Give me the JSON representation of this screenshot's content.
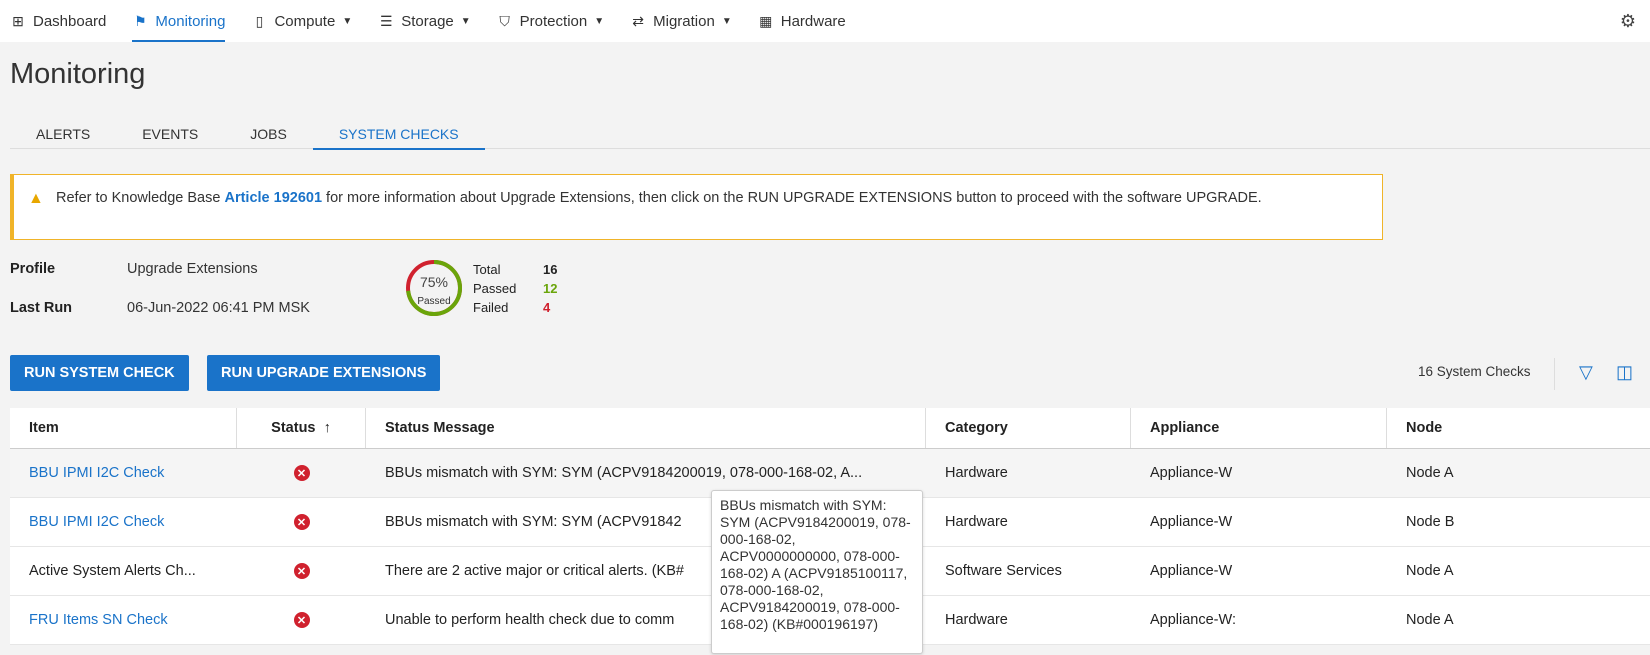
{
  "nav": {
    "items": [
      {
        "label": "Dashboard",
        "icon": "grid-icon"
      },
      {
        "label": "Monitoring",
        "icon": "flag-icon",
        "active": true
      },
      {
        "label": "Compute",
        "icon": "device-icon",
        "dropdown": true
      },
      {
        "label": "Storage",
        "icon": "database-icon",
        "dropdown": true
      },
      {
        "label": "Protection",
        "icon": "shield-icon",
        "dropdown": true
      },
      {
        "label": "Migration",
        "icon": "migration-icon",
        "dropdown": true
      },
      {
        "label": "Hardware",
        "icon": "hardware-icon"
      }
    ]
  },
  "page_title": "Monitoring",
  "tabs": [
    "ALERTS",
    "EVENTS",
    "JOBS",
    "SYSTEM CHECKS"
  ],
  "banner": {
    "pre": "Refer to Knowledge Base ",
    "link": "Article 192601",
    "post": " for more information about Upgrade Extensions, then click on the RUN UPGRADE EXTENSIONS button to proceed with the software UPGRADE."
  },
  "profile": {
    "label": "Profile",
    "value": "Upgrade Extensions"
  },
  "last_run": {
    "label": "Last Run",
    "value": "06-Jun-2022 06:41 PM MSK"
  },
  "summary": {
    "percent": "75%",
    "percent_value": 75,
    "percent_label": "Passed",
    "total_label": "Total",
    "total": "16",
    "passed_label": "Passed",
    "passed": "12",
    "failed_label": "Failed",
    "failed": "4",
    "colors": {
      "passed": "#6aa50a",
      "failed": "#d0212e"
    }
  },
  "buttons": {
    "run_system_check": "RUN SYSTEM CHECK",
    "run_upgrade_extensions": "RUN UPGRADE EXTENSIONS"
  },
  "count_label": "16 System Checks",
  "table": {
    "headers": [
      "Item",
      "Status",
      "Status Message",
      "Category",
      "Appliance",
      "Node"
    ],
    "sort_indicator": "↑",
    "rows": [
      {
        "item": "BBU IPMI I2C Check",
        "link": true,
        "status": "error",
        "message": "BBUs mismatch with SYM: SYM (ACPV9184200019, 078-000-168-02, A...",
        "category": "Hardware",
        "appliance": "Appliance-W",
        "node": "Node A"
      },
      {
        "item": "BBU IPMI I2C Check",
        "link": true,
        "status": "error",
        "message": "BBUs mismatch with SYM: SYM (ACPV91842",
        "category": "Hardware",
        "appliance": "Appliance-W",
        "node": "Node B"
      },
      {
        "item": "Active System Alerts Ch...",
        "link": false,
        "status": "error",
        "message": "There are 2 active major or critical alerts. (KB#",
        "category": "Software Services",
        "appliance": "Appliance-W",
        "node": "Node A"
      },
      {
        "item": "FRU Items SN Check",
        "link": true,
        "status": "error",
        "message": "Unable to perform health check due to comm",
        "category": "Hardware",
        "appliance": "Appliance-W:",
        "node": "Node A"
      }
    ]
  },
  "tooltip": "BBUs mismatch with SYM: SYM (ACPV9184200019, 078-000-168-02, ACPV0000000000, 078-000-168-02) A (ACPV9185100117, 078-000-168-02, ACPV9184200019, 078-000-168-02) (KB#000196197)"
}
